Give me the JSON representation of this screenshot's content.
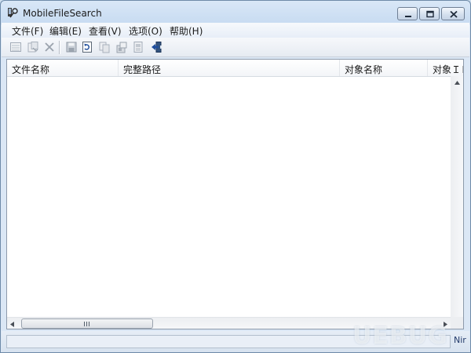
{
  "window": {
    "title": "MobileFileSearch"
  },
  "menu": [
    {
      "label": "文件(F)"
    },
    {
      "label": "编辑(E)"
    },
    {
      "label": "查看(V)"
    },
    {
      "label": "选项(O)"
    },
    {
      "label": "帮助(H)"
    }
  ],
  "toolbar": {
    "icons": [
      "new-icon",
      "open-icon",
      "delete-icon",
      "save-icon",
      "refresh-icon",
      "copy-icon",
      "properties-icon",
      "report-icon",
      "exit-icon"
    ]
  },
  "listview": {
    "columns": [
      {
        "label": "文件名称"
      },
      {
        "label": "完整路径"
      },
      {
        "label": "对象名称"
      },
      {
        "label": "对象ＩＤ"
      }
    ],
    "rows": []
  },
  "scrollbar": {
    "grip": "III"
  },
  "statusbar": {
    "text": "Nir"
  },
  "watermark": {
    "text": "UEBUG"
  },
  "colors": {
    "accent": "#1f4e9c",
    "titlebar": "#c7dbf1",
    "close_button": "#c9443a"
  }
}
